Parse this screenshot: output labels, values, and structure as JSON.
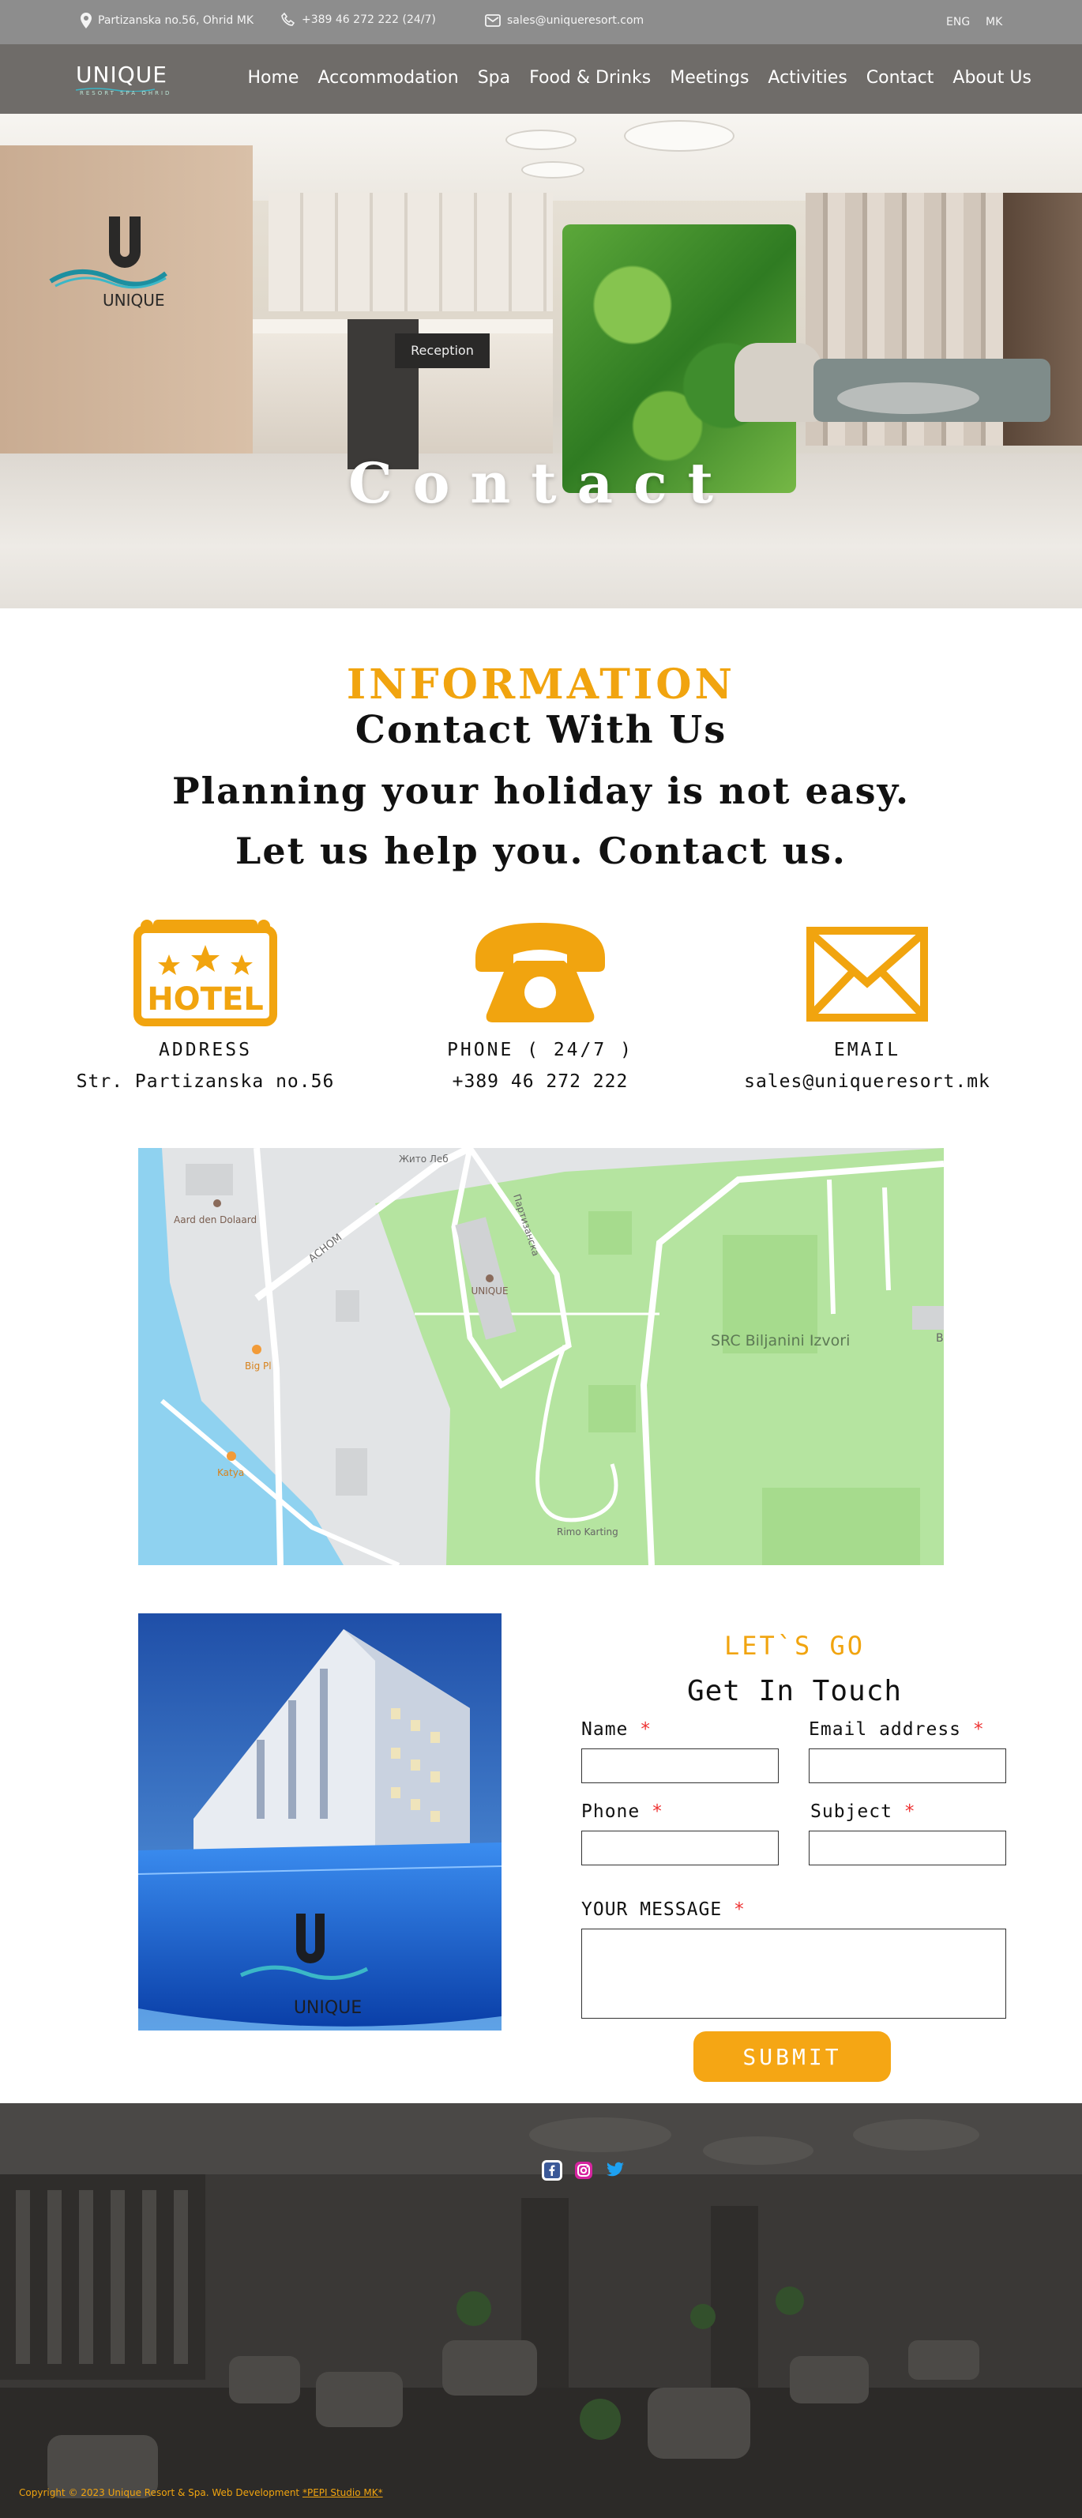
{
  "topbar": {
    "address": "Partizanska no.56, Ohrid MK",
    "phone": "+389 46 272 222  (24/7)",
    "email": "sales@uniqueresort.com",
    "languages": [
      "ENG",
      "MK"
    ]
  },
  "nav": {
    "logo": "UNIQUE",
    "logo_sub": "RESORT SPA OHRID",
    "items": [
      "Home",
      "Accommodation",
      "Spa",
      "Food & Drinks",
      "Meetings",
      "Activities",
      "Contact",
      "About Us"
    ]
  },
  "hero": {
    "title": "Contact",
    "reception_sign": "Reception",
    "logo_text": "UNIQUE"
  },
  "info": {
    "kicker": "INFORMATION",
    "title": "Contact With Us",
    "line1": "Planning your holiday is not easy.",
    "line2": "Let us help you. Contact us."
  },
  "contacts": [
    {
      "label": "ADDRESS",
      "value": "Str. Partizanska no.56",
      "icon": "hotel-sign-icon",
      "icon_text": "HOTEL"
    },
    {
      "label": "PHONE ( 24/7 )",
      "value": "+389 46 272 222",
      "icon": "phone-icon"
    },
    {
      "label": "EMAIL",
      "value": "sales@uniqueresort.mk",
      "icon": "envelope-icon"
    }
  ],
  "map": {
    "labels": [
      "Жито Леб",
      "Партизанска",
      "UNIQUE",
      "Aard den Dolaard",
      "АСНОМ",
      "SRC Biljanini Izvori",
      "Big Pl",
      "Katya",
      "Rimo Karting",
      "B"
    ]
  },
  "photo": {
    "logo_text": "UNIQUE"
  },
  "form": {
    "kicker": "LET`S GO",
    "title": "Get In Touch",
    "name_label": "Name",
    "email_label": "Email address",
    "phone_label": "Phone",
    "subject_label": "Subject",
    "message_label": "YOUR MESSAGE",
    "required_mark": "*",
    "submit": "SUBMIT"
  },
  "footer": {
    "social": [
      "facebook-icon",
      "instagram-icon",
      "twitter-icon"
    ],
    "copyright": "Copyright © 2023 Unique Resort & Spa. Web Development ",
    "credit": "*PEPI Studio MK*"
  },
  "colors": {
    "accent": "#f1a40f",
    "nav": "#6f6c69",
    "topbar": "#8d8d8d",
    "map_green": "#b5e4a0",
    "footer": "#3b3937"
  }
}
